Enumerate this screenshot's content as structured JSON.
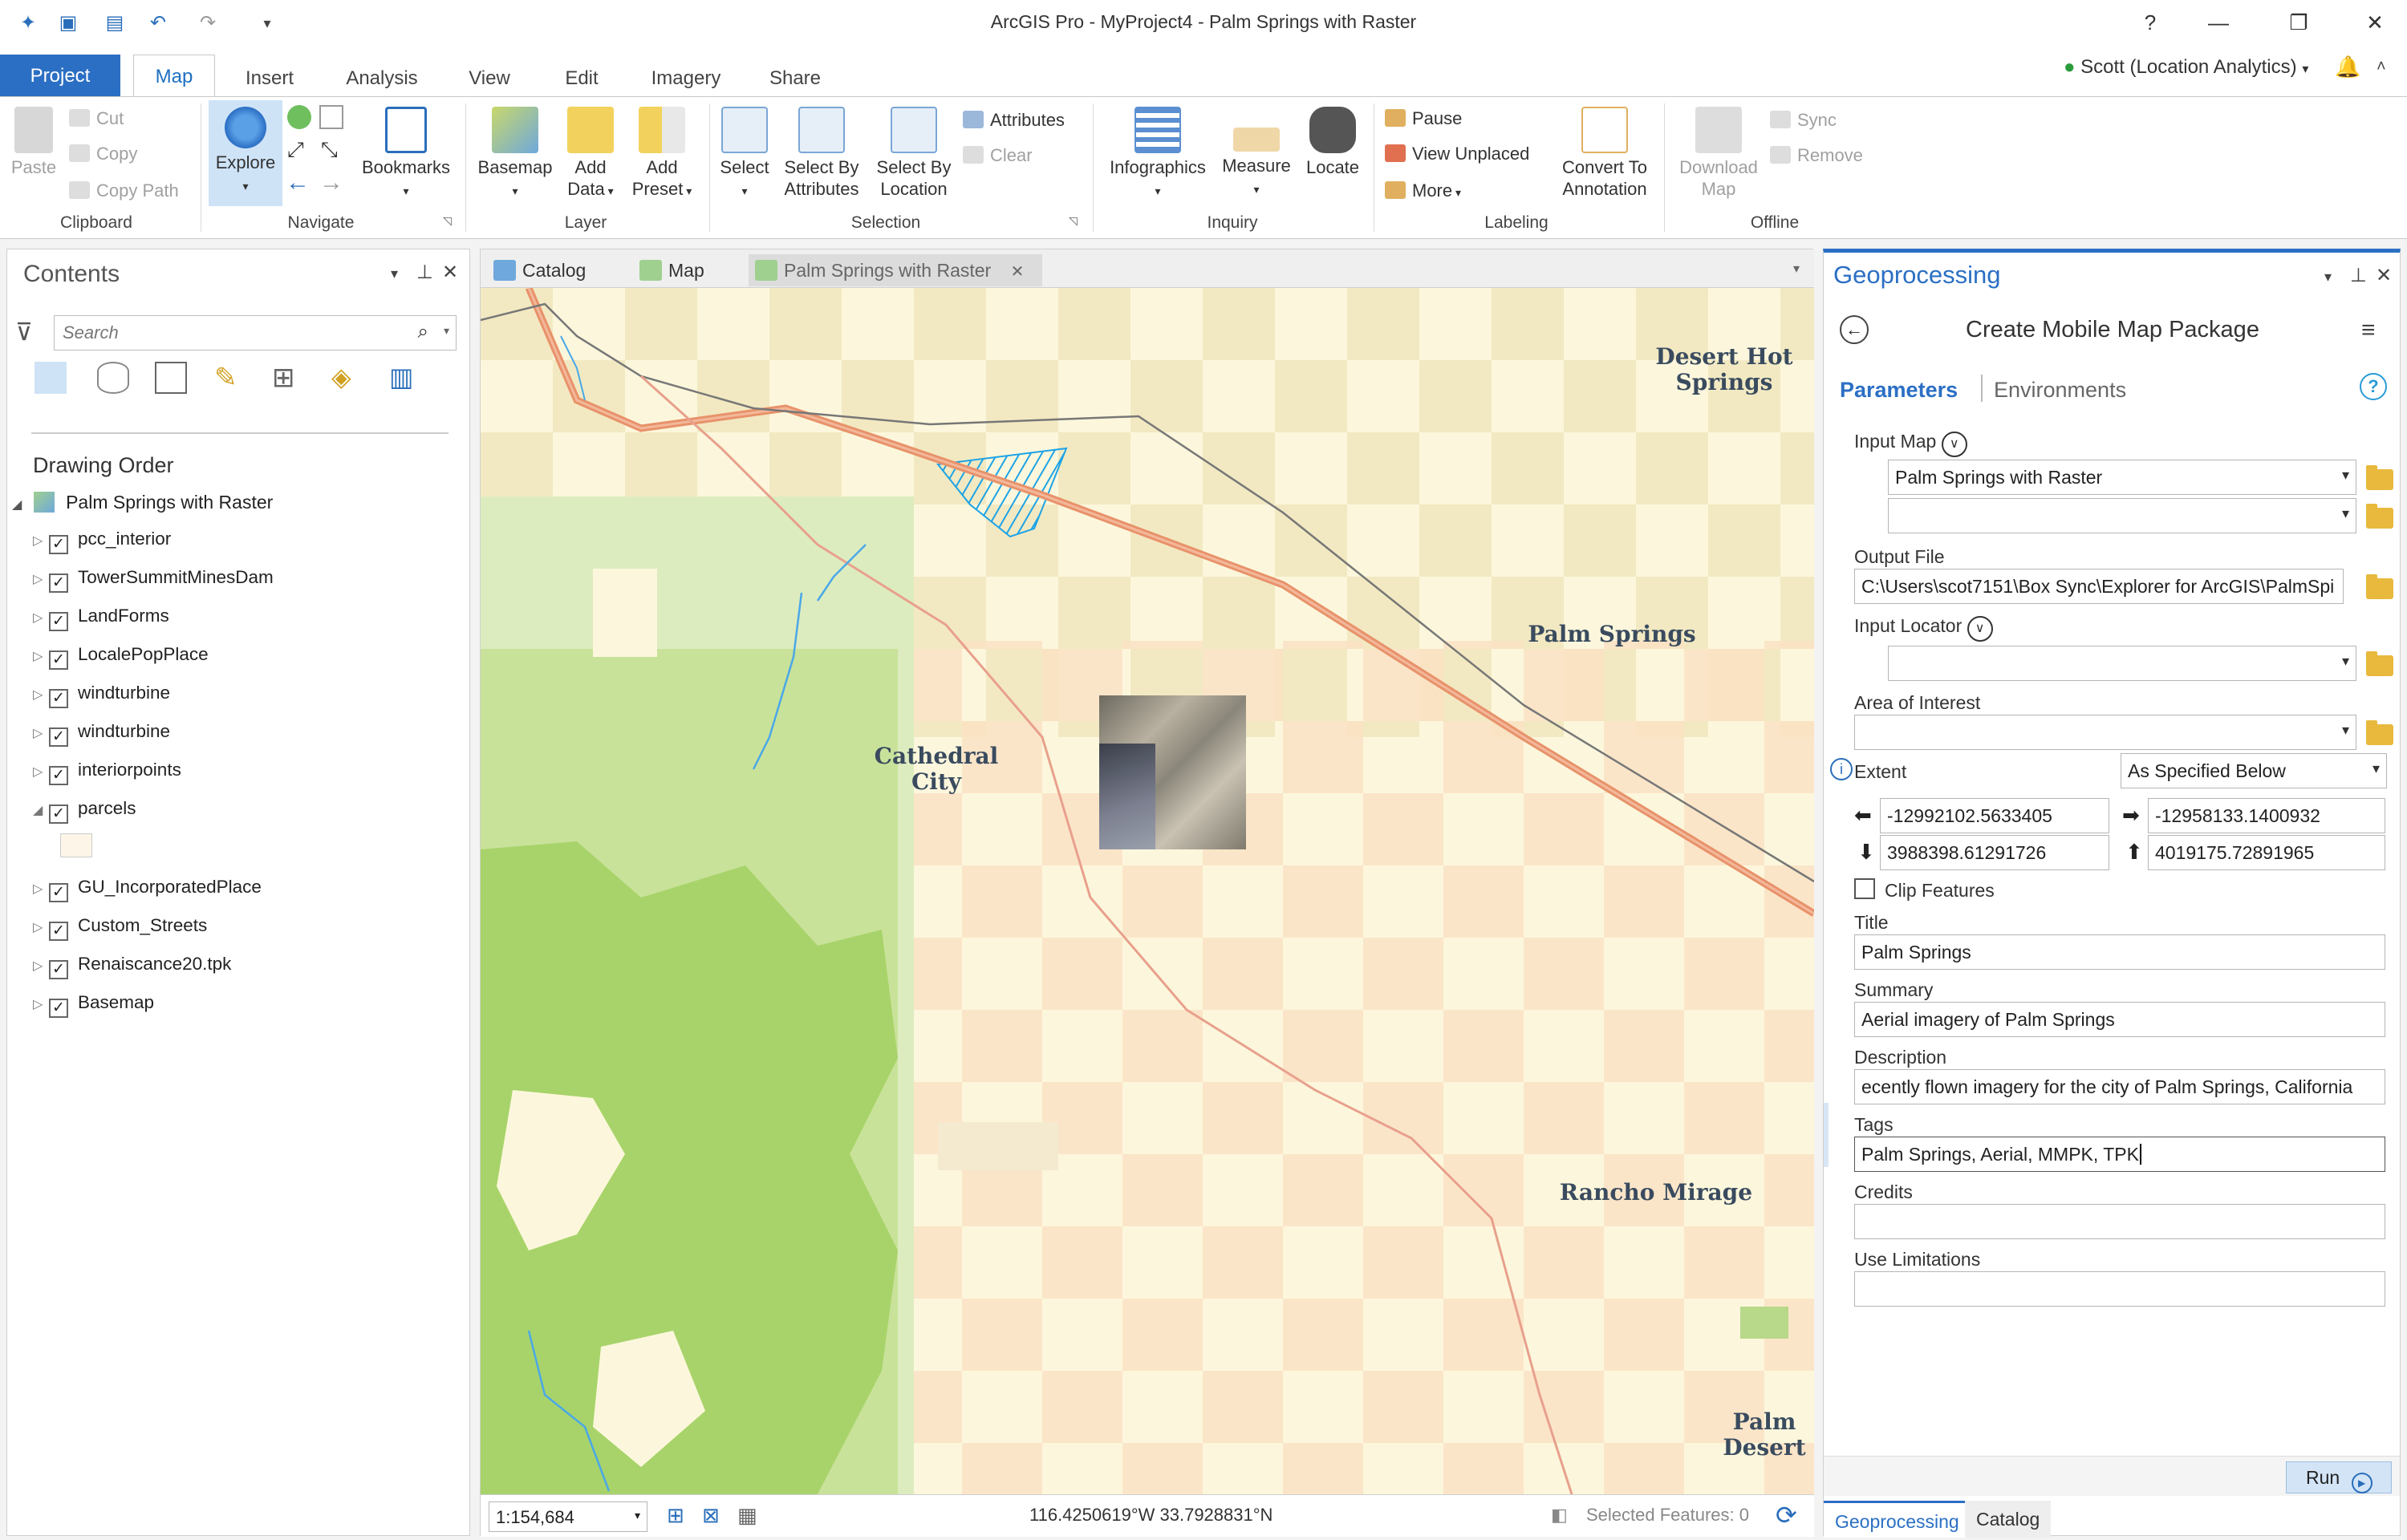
{
  "window": {
    "title": "ArcGIS Pro - MyProject4 - Palm Springs with Raster",
    "help": "?",
    "minimize": "—",
    "restore": "❐",
    "close": "✕"
  },
  "ribbon_tabs": [
    "Project",
    "Map",
    "Insert",
    "Analysis",
    "View",
    "Edit",
    "Imagery",
    "Share"
  ],
  "user": "Scott (Location Analytics)",
  "ribbon": {
    "clipboard": {
      "paste": "Paste",
      "cut": "Cut",
      "copy": "Copy",
      "copy_path": "Copy Path",
      "group": "Clipboard"
    },
    "navigate": {
      "explore": "Explore",
      "bookmarks": "Bookmarks",
      "group": "Navigate"
    },
    "layer": {
      "basemap": "Basemap",
      "add_data_1": "Add",
      "add_data_2": "Data",
      "add_preset_1": "Add",
      "add_preset_2": "Preset",
      "group": "Layer"
    },
    "selection": {
      "select": "Select",
      "select_by_attr_1": "Select By",
      "select_by_attr_2": "Attributes",
      "select_by_loc_1": "Select By",
      "select_by_loc_2": "Location",
      "attributes": "Attributes",
      "clear": "Clear",
      "group": "Selection"
    },
    "inquiry": {
      "infographics": "Infographics",
      "measure": "Measure",
      "locate": "Locate",
      "group": "Inquiry"
    },
    "labeling": {
      "pause": "Pause",
      "view_unplaced": "View Unplaced",
      "more": "More",
      "convert_1": "Convert To",
      "convert_2": "Annotation",
      "group": "Labeling"
    },
    "offline": {
      "download_1": "Download",
      "download_2": "Map",
      "sync": "Sync",
      "remove": "Remove",
      "group": "Offline"
    }
  },
  "contents": {
    "title": "Contents",
    "search_placeholder": "Search",
    "drawing_order": "Drawing Order",
    "map_name": "Palm Springs with Raster",
    "layers": [
      {
        "name": "pcc_interior",
        "checked": true,
        "expanded": false
      },
      {
        "name": "TowerSummitMinesDam",
        "checked": true,
        "expanded": false
      },
      {
        "name": "LandForms",
        "checked": true,
        "expanded": false
      },
      {
        "name": "LocalePopPlace",
        "checked": true,
        "expanded": false
      },
      {
        "name": "windturbine",
        "checked": true,
        "expanded": false
      },
      {
        "name": "windturbine",
        "checked": true,
        "expanded": false
      },
      {
        "name": "interiorpoints",
        "checked": true,
        "expanded": false
      },
      {
        "name": "parcels",
        "checked": true,
        "expanded": true
      },
      {
        "name": "GU_IncorporatedPlace",
        "checked": true,
        "expanded": false
      },
      {
        "name": "Custom_Streets",
        "checked": true,
        "expanded": false
      },
      {
        "name": "Renaiscance20.tpk",
        "checked": true,
        "expanded": false
      },
      {
        "name": "Basemap",
        "checked": true,
        "expanded": false
      }
    ]
  },
  "view_tabs": [
    "Catalog",
    "Map",
    "Palm Springs with Raster"
  ],
  "map": {
    "labels": {
      "desert_hot_springs": "Desert Hot\nSprings",
      "palm_springs": "Palm Springs",
      "cathedral_city": "Cathedral\nCity",
      "rancho_mirage": "Rancho Mirage",
      "palm_desert": "Palm\nDesert"
    },
    "scale": "1:154,684",
    "coordinates": "116.4250619°W 33.7928831°N",
    "selected_features": "Selected Features: 0"
  },
  "geoprocessing": {
    "title": "Geoprocessing",
    "tool_name": "Create Mobile Map Package",
    "tab_parameters": "Parameters",
    "tab_environments": "Environments",
    "input_map_label": "Input Map",
    "input_map_value": "Palm Springs with Raster",
    "output_file_label": "Output File",
    "output_file_value": "C:\\Users\\scot7151\\Box Sync\\Explorer for ArcGIS\\PalmSpi",
    "input_locator_label": "Input Locator",
    "area_of_interest_label": "Area of Interest",
    "extent_label": "Extent",
    "extent_value": "As Specified Below",
    "extent_left": "-12992102.5633405",
    "extent_right": "-12958133.1400932",
    "extent_bottom": "3988398.61291726",
    "extent_top": "4019175.72891965",
    "clip_features": "Clip Features",
    "title_label": "Title",
    "title_value": "Palm Springs",
    "summary_label": "Summary",
    "summary_value": "Aerial imagery of Palm Springs",
    "description_label": "Description",
    "description_value": "ecently flown imagery for the city of Palm Springs, California",
    "tags_label": "Tags",
    "tags_value": "Palm Springs, Aerial, MMPK, TPK",
    "credits_label": "Credits",
    "use_limitations_label": "Use Limitations",
    "run": "Run",
    "bottom_tab_geoprocessing": "Geoprocessing",
    "bottom_tab_catalog": "Catalog"
  }
}
